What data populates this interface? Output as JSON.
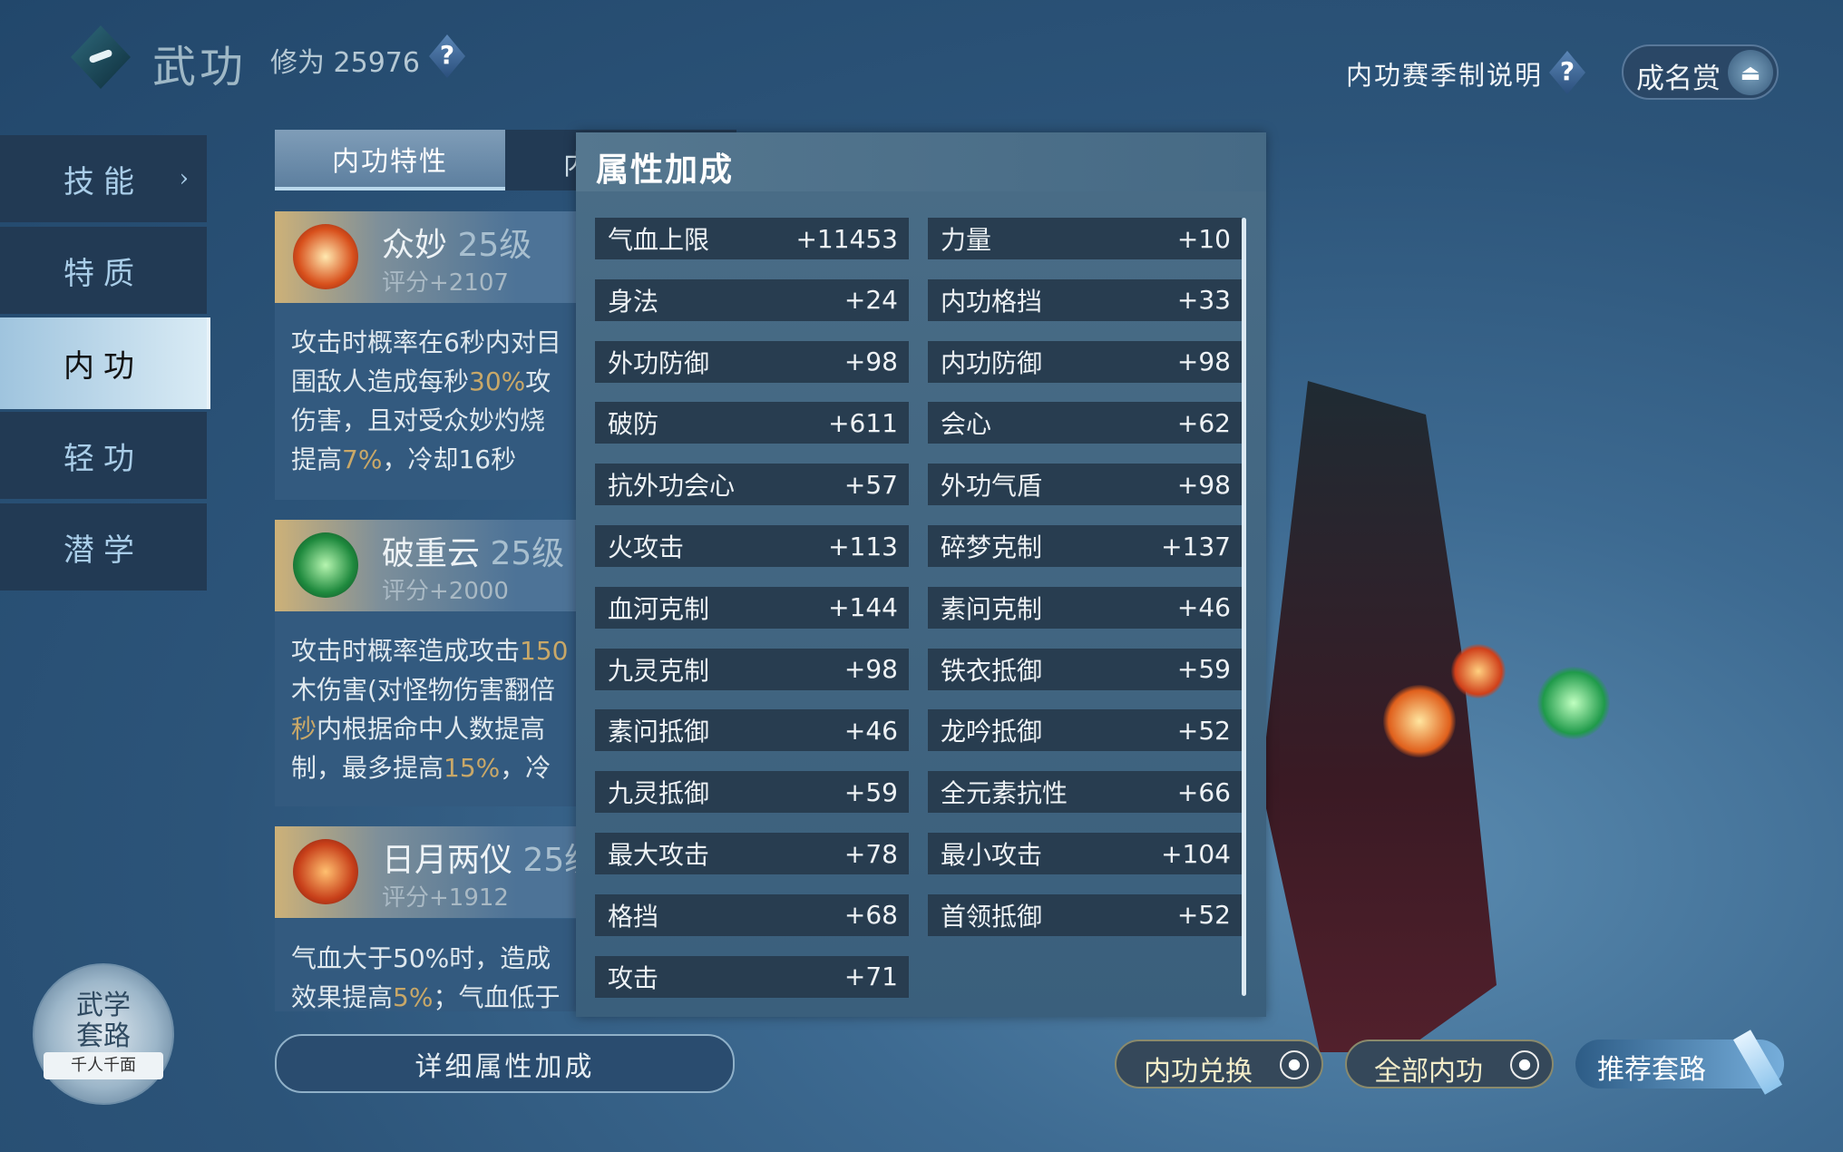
{
  "header": {
    "title": "武功",
    "cultivation_label": "修为",
    "cultivation_value": "25976",
    "help_icon": "question-diamond-icon"
  },
  "sidebar": {
    "items": [
      {
        "label": "技能",
        "has_arrow": true
      },
      {
        "label": "特质"
      },
      {
        "label": "内功",
        "selected": true
      },
      {
        "label": "轻功"
      },
      {
        "label": "潜学"
      }
    ]
  },
  "tabs": [
    {
      "label": "内功特性",
      "selected": true
    },
    {
      "label": "内"
    }
  ],
  "cards": [
    {
      "name": "众妙",
      "level": "25级",
      "score": "评分+2107",
      "lines": [
        [
          "攻击时概率在6秒内对目"
        ],
        [
          "围敌人造成每秒",
          "30%",
          "攻"
        ],
        [
          "伤害，且对受众妙灼烧"
        ],
        [
          "提高",
          "7%",
          "，冷却16秒"
        ]
      ]
    },
    {
      "name": "破重云",
      "level": "25级",
      "score": "评分+2000",
      "lines": [
        [
          "攻击时概率造成攻击",
          "150"
        ],
        [
          "木伤害(对怪物伤害翻倍"
        ],
        [
          "",
          "秒",
          "内根据命中人数提高"
        ],
        [
          "制，最多提高",
          "15%",
          "，冷"
        ]
      ]
    },
    {
      "name": "日月两仪",
      "level": "25级",
      "score": "评分+1912",
      "lines": [
        [
          "气血大于50%时，造成"
        ],
        [
          "效果提高",
          "5%",
          "；气血低于"
        ]
      ]
    }
  ],
  "detail_button": "详细属性加成",
  "attr_panel": {
    "title": "属性加成",
    "rows": [
      [
        {
          "name": "气血上限",
          "value": "+11453"
        },
        {
          "name": "力量",
          "value": "+10"
        }
      ],
      [
        {
          "name": "身法",
          "value": "+24"
        },
        {
          "name": "内功格挡",
          "value": "+33"
        }
      ],
      [
        {
          "name": "外功防御",
          "value": "+98"
        },
        {
          "name": "内功防御",
          "value": "+98"
        }
      ],
      [
        {
          "name": "破防",
          "value": "+611"
        },
        {
          "name": "会心",
          "value": "+62"
        }
      ],
      [
        {
          "name": "抗外功会心",
          "value": "+57"
        },
        {
          "name": "外功气盾",
          "value": "+98"
        }
      ],
      [
        {
          "name": "火攻击",
          "value": "+113"
        },
        {
          "name": "碎梦克制",
          "value": "+137"
        }
      ],
      [
        {
          "name": "血河克制",
          "value": "+144"
        },
        {
          "name": "素问克制",
          "value": "+46"
        }
      ],
      [
        {
          "name": "九灵克制",
          "value": "+98"
        },
        {
          "name": "铁衣抵御",
          "value": "+59"
        }
      ],
      [
        {
          "name": "素问抵御",
          "value": "+46"
        },
        {
          "name": "龙吟抵御",
          "value": "+52"
        }
      ],
      [
        {
          "name": "九灵抵御",
          "value": "+59"
        },
        {
          "name": "全元素抗性",
          "value": "+66"
        }
      ],
      [
        {
          "name": "最大攻击",
          "value": "+78"
        },
        {
          "name": "最小攻击",
          "value": "+104"
        }
      ],
      [
        {
          "name": "格挡",
          "value": "+68"
        },
        {
          "name": "首领抵御",
          "value": "+52"
        }
      ],
      [
        {
          "name": "攻击",
          "value": "+71"
        }
      ]
    ]
  },
  "top_right": {
    "season_help": "内功赛季制说明",
    "fame_button": "成名赏"
  },
  "bottom_buttons": {
    "exchange": "内功兑换",
    "all": "全部内功",
    "recommend": "推荐套路"
  },
  "badge": {
    "line1": "武学",
    "line2": "套路",
    "sub": "千人千面"
  },
  "colors": {
    "highlight": "#c9a868",
    "panel_row": "#283d50",
    "selected_tab": "#d9ebf5"
  }
}
